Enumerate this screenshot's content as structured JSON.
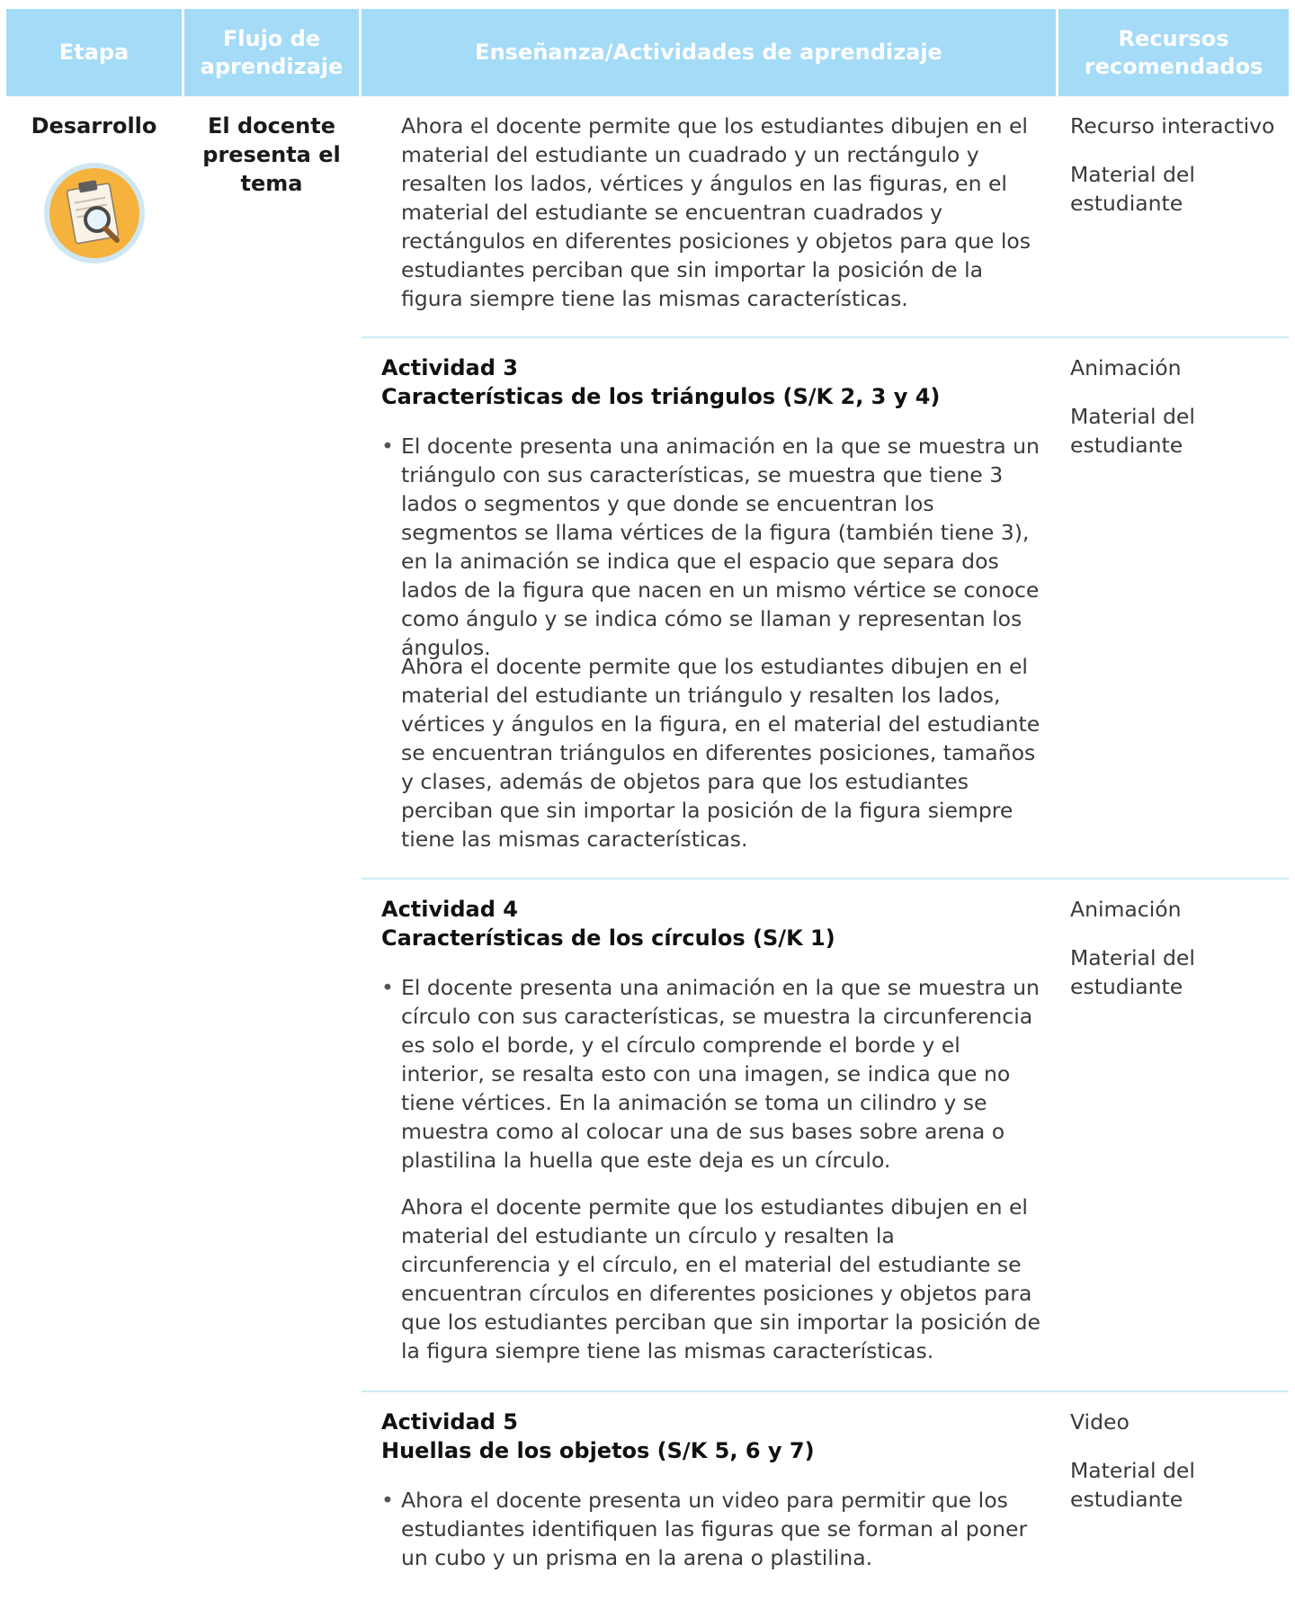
{
  "header": {
    "etapa": "Etapa",
    "flujo": "Flujo de aprendizaje",
    "ensenanza": "Enseñanza/Actividades de aprendizaje",
    "recursos": "Recursos recomendados"
  },
  "stage": {
    "label": "Desarrollo",
    "icon": "clipboard-magnifier-icon"
  },
  "flow": {
    "label": "El docente presenta el tema"
  },
  "sections": [
    {
      "paragraphs": [
        "Ahora el docente permite que los estudiantes dibujen en el material del estudiante un cuadrado y un rectángulo y resalten los lados, vértices y ángulos en las figuras, en el material del estudiante se encuentran cuadrados y rectángulos en diferentes posiciones y objetos para que los estudiantes perciban que sin importar la posición de la figura siempre tiene las mismas características."
      ],
      "resources": [
        "Recurso interactivo",
        "Material del estudiante"
      ]
    },
    {
      "activity": "Actividad 3",
      "title": "Características de los triángulos (S/K 2, 3 y 4)",
      "bullet": "El docente presenta una animación en la que se muestra un triángulo con sus características, se muestra que tiene 3 lados o segmentos y que donde se encuentran los segmentos se llama vértices de la figura (también tiene 3), en la animación se indica que el espacio que separa dos lados de la figura que nacen en un mismo vértice se conoce como ángulo y se indica cómo se llaman y representan los ángulos.",
      "paragraph": "Ahora el docente permite que los estudiantes dibujen en el material del estudiante un triángulo y resalten los lados, vértices y ángulos en la figura, en el material del estudiante se encuentran triángulos en diferentes posiciones, tamaños y clases, además de objetos para que los estudiantes perciban que sin importar la posición de la figura siempre tiene las mismas características.",
      "resources": [
        "Animación",
        "Material del estudiante"
      ]
    },
    {
      "activity": "Actividad 4",
      "title": "Características de los círculos (S/K 1)",
      "bullet": "El docente presenta una animación en la que se muestra un círculo con sus características, se muestra la circunferencia es solo el borde, y el círculo comprende el borde y el interior, se resalta esto con una imagen, se indica que no tiene vértices. En la animación se toma un cilindro y se muestra como al colocar una de sus bases sobre arena o plastilina la huella que este deja es un círculo.",
      "paragraph": "Ahora el docente permite que los estudiantes dibujen en el material del estudiante un círculo y resalten la circunferencia y el círculo, en el material del estudiante se encuentran círculos en diferentes posiciones y objetos para que los estudiantes perciban que sin importar la posición de la figura siempre tiene las mismas características.",
      "resources": [
        "Animación",
        "Material del estudiante"
      ]
    },
    {
      "activity": "Actividad 5",
      "title": "Huellas de los objetos (S/K 5, 6 y 7)",
      "bullet": "Ahora el docente presenta un video para permitir que los estudiantes identifiquen las figuras que se forman al poner un cubo y un prisma en la arena o plastilina.",
      "resources": [
        "Video",
        "Material del estudiante"
      ]
    }
  ],
  "colors": {
    "header_bg": "#a4dbf7",
    "header_text": "#ffffff",
    "divider": "#cfeaf7",
    "icon_circle": "#f5b23d",
    "icon_ring": "#cfe7f3"
  }
}
